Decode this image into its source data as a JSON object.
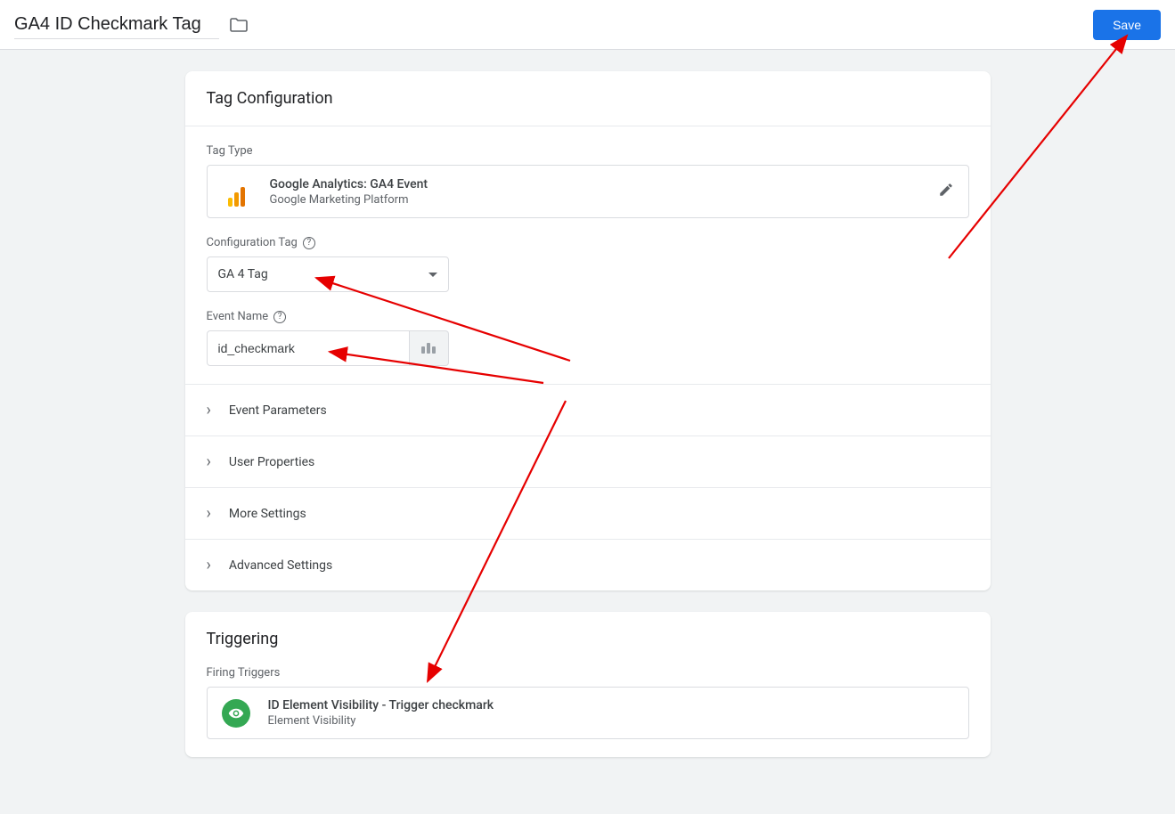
{
  "header": {
    "title": "GA4 ID Checkmark Tag",
    "save_label": "Save"
  },
  "tag_config": {
    "panel_title": "Tag Configuration",
    "tag_type_label": "Tag Type",
    "tag_type_name": "Google Analytics: GA4 Event",
    "tag_type_vendor": "Google Marketing Platform",
    "config_tag_label": "Configuration Tag",
    "config_tag_value": "GA 4 Tag",
    "event_name_label": "Event Name",
    "event_name_value": "id_checkmark",
    "collapsibles": [
      {
        "label": "Event Parameters"
      },
      {
        "label": "User Properties"
      },
      {
        "label": "More Settings"
      },
      {
        "label": "Advanced Settings"
      }
    ]
  },
  "triggering": {
    "panel_title": "Triggering",
    "section_label": "Firing Triggers",
    "trigger_name": "ID Element Visibility - Trigger checkmark",
    "trigger_type": "Element Visibility"
  }
}
